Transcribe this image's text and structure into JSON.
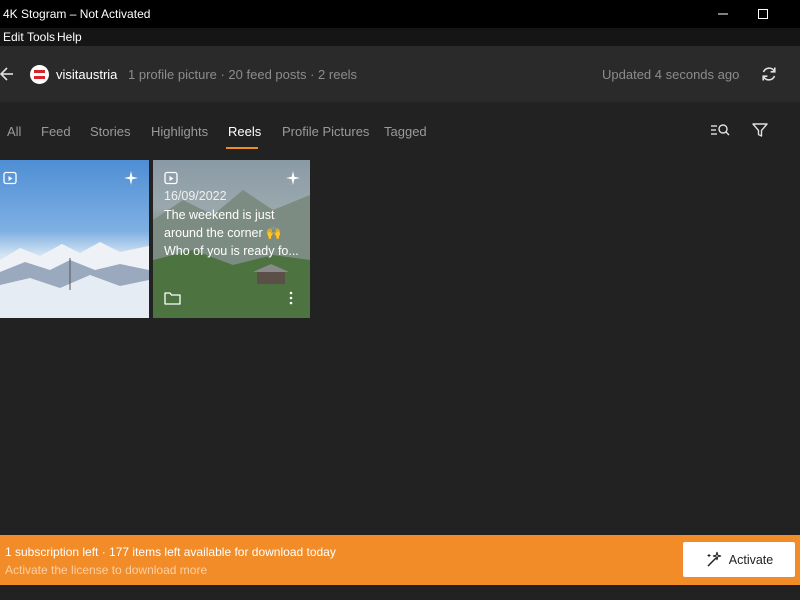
{
  "window": {
    "title": "4K Stogram – Not Activated"
  },
  "menu": {
    "items": [
      "Edit",
      "Tools",
      "Help"
    ]
  },
  "header": {
    "username": "visitaustria",
    "stats": "1 profile picture · 20 feed posts · 2 reels",
    "updated": "Updated 4 seconds ago"
  },
  "tabs": {
    "items": [
      "All",
      "Feed",
      "Stories",
      "Highlights",
      "Reels",
      "Profile Pictures",
      "Tagged"
    ],
    "active": "Reels"
  },
  "reels": [
    {
      "date": "",
      "lines": []
    },
    {
      "date": "16/09/2022",
      "lines": [
        "The weekend is just",
        "around the corner 🙌",
        "Who of you is ready fo..."
      ]
    }
  ],
  "banner": {
    "main": "1 subscription left · 177 items left available for download today",
    "sub": "Activate the license to download more",
    "button_label": "Activate"
  },
  "colors": {
    "accent": "#f28c28",
    "background": "#222222",
    "header_bg": "#2a2a2a"
  },
  "icons": {
    "back": "arrow-left-icon",
    "refresh": "refresh-icon",
    "search_list": "search-list-icon",
    "filter": "filter-icon",
    "reel_badge": "reel-icon",
    "sparkle": "sparkle-icon",
    "folder": "folder-icon",
    "more": "more-vertical-icon",
    "activate": "magic-wand-icon"
  }
}
